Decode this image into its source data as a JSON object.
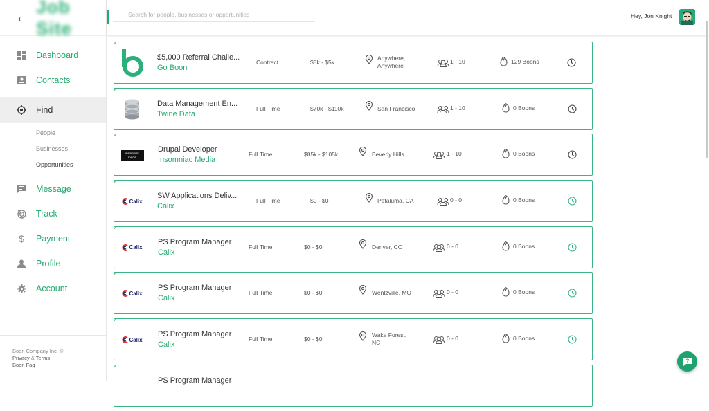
{
  "app": {
    "logo_text": "Job Site"
  },
  "header": {
    "search_placeholder": "Search for people, businesses or opportunities",
    "greeting": "Hey, Jon Knight"
  },
  "sidebar": {
    "items": [
      {
        "label": "Dashboard",
        "icon": "dashboard-icon"
      },
      {
        "label": "Contacts",
        "icon": "contacts-icon"
      },
      {
        "label": "Find",
        "icon": "target-icon",
        "active": true
      },
      {
        "label": "Message",
        "icon": "message-icon"
      },
      {
        "label": "Track",
        "icon": "track-icon"
      },
      {
        "label": "Payment",
        "icon": "dollar-icon"
      },
      {
        "label": "Profile",
        "icon": "person-icon"
      },
      {
        "label": "Account",
        "icon": "gear-icon"
      }
    ],
    "find_sub": [
      "People",
      "Businesses",
      "Opportunities"
    ],
    "footer": {
      "copyright": "Boon Company Inc. ©",
      "privacy": "Privacy",
      "amp": "&",
      "terms": "Terms",
      "faq": "Boon Faq"
    }
  },
  "colors": {
    "accent": "#24a96f",
    "border": "#3bb583"
  },
  "opportunities": [
    {
      "title": "$5,000 Referral Challe...",
      "company": "Go Boon",
      "logo": "goboon-logo",
      "type": "Contract",
      "pay": "$5k - $5k",
      "location": "Anywhere, Anywhere",
      "size": "1 - 10",
      "boons": "129 Boons",
      "clock_active": false
    },
    {
      "title": "Data Management En...",
      "company": "Twine Data",
      "logo": "database-logo",
      "type": "Full Time",
      "pay": "$70k - $110k",
      "location": "San Francisco",
      "size": "1 - 10",
      "boons": "0 Boons",
      "clock_active": false
    },
    {
      "title": "Drupal Developer",
      "company": "Insomniac Media",
      "logo": "insomniac-logo",
      "logo_text": "insomniac media",
      "type": "Full Time",
      "pay": "$85k - $105k",
      "location": "Beverly Hills",
      "size": "1 - 10",
      "boons": "0 Boons",
      "clock_active": false
    },
    {
      "title": "SW Applications Deliv...",
      "company": "Calix",
      "logo": "calix-logo",
      "logo_text": "Calix",
      "type": "Full Time",
      "pay": "$0 - $0",
      "location": "Petaluma, CA",
      "size": "0 - 0",
      "boons": "0 Boons",
      "clock_active": true
    },
    {
      "title": "PS Program Manager",
      "company": "Calix",
      "logo": "calix-logo",
      "logo_text": "Calix",
      "type": "Full Time",
      "pay": "$0 - $0",
      "location": "Denver, CO",
      "size": "0 - 0",
      "boons": "0 Boons",
      "clock_active": true
    },
    {
      "title": "PS Program Manager",
      "company": "Calix",
      "logo": "calix-logo",
      "logo_text": "Calix",
      "type": "Full Time",
      "pay": "$0 - $0",
      "location": "Wentzville, MO",
      "size": "0 - 0",
      "boons": "0 Boons",
      "clock_active": true
    },
    {
      "title": "PS Program Manager",
      "company": "Calix",
      "logo": "calix-logo",
      "logo_text": "Calix",
      "type": "Full Time",
      "pay": "$0 - $0",
      "location": "Wake Forest, NC",
      "size": "0 - 0",
      "boons": "0 Boons",
      "clock_active": true
    },
    {
      "title": "PS Program Manager",
      "company": "",
      "logo": "",
      "type": "",
      "pay": "",
      "location": "",
      "size": "",
      "boons": "",
      "clock_active": false
    }
  ]
}
